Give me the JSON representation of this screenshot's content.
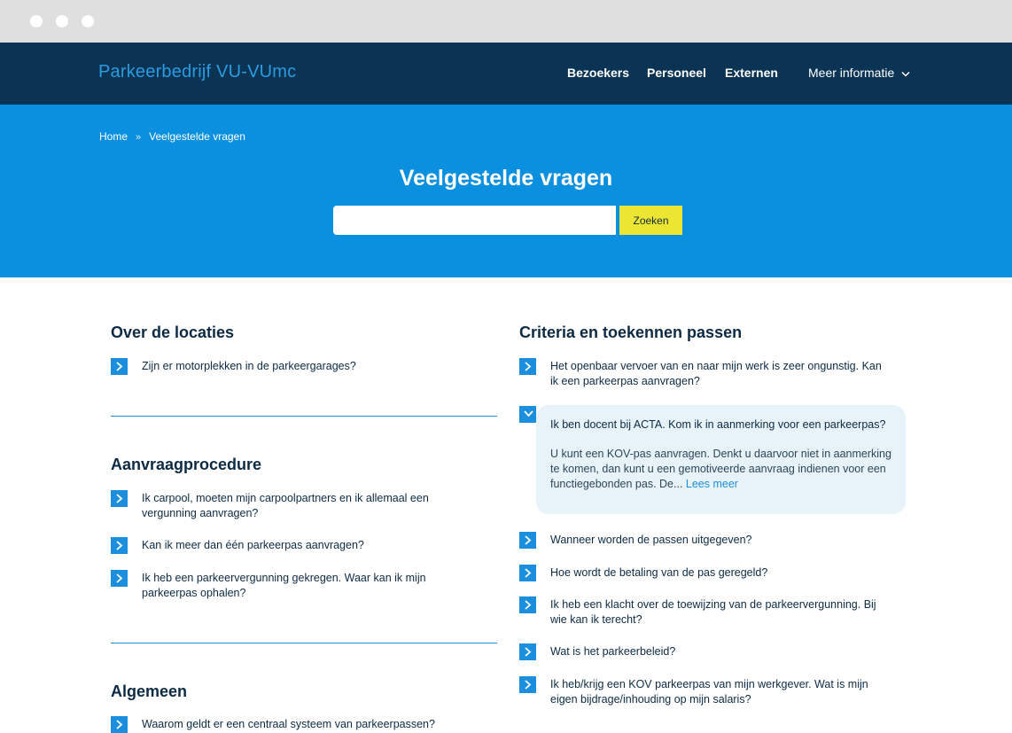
{
  "colors": {
    "navbar_bg": "#0b3454",
    "brand": "#2a9be0",
    "hero_bg": "#0b90df",
    "search_button": "#ece531",
    "accent": "#1b8fde",
    "answer_bg": "#e8f2f9"
  },
  "header": {
    "brand": "Parkeerbedrijf VU-VUmc",
    "nav": {
      "bezoekers": "Bezoekers",
      "personeel": "Personeel",
      "externen": "Externen",
      "meer": "Meer informatie"
    }
  },
  "breadcrumb": {
    "home": "Home",
    "separator": "»",
    "current": "Veelgestelde vragen"
  },
  "hero": {
    "title": "Veelgestelde vragen",
    "search_value": "",
    "search_button": "Zoeken"
  },
  "left": {
    "locaties": {
      "title": "Over de locaties",
      "questions": [
        "Zijn er motorplekken in de parkeergarages?"
      ]
    },
    "aanvraag": {
      "title": "Aanvraagprocedure",
      "questions": [
        "Ik carpool, moeten mijn carpoolpartners en ik allemaal een vergunning aanvragen?",
        "Kan ik meer dan één parkeerpas aanvragen?",
        "Ik heb een parkeervergunning gekregen. Waar kan ik mijn parkeerpas ophalen?"
      ]
    },
    "algemeen": {
      "title": "Algemeen",
      "questions": [
        "Waarom geldt er een centraal systeem van parkeerpassen?"
      ]
    }
  },
  "right": {
    "title": "Criteria en toekennen passen",
    "questions": [
      "Het openbaar vervoer van en naar mijn werk is zeer ongunstig. Kan ik een parkeerpas aanvragen?",
      "Ik ben docent bij ACTA. Kom ik in aanmerking voor een parkeerpas?",
      "Wanneer worden de passen uitgegeven?",
      "Hoe wordt de betaling van de pas geregeld?",
      "Ik heb een klacht over de toewijzing van de parkeervergunning. Bij wie kan ik terecht?",
      "Wat is het parkeerbeleid?",
      "Ik heb/krijg een KOV parkeerpas van mijn werkgever. Wat is mijn eigen bijdrage/inhouding op mijn salaris?"
    ],
    "open_answer": {
      "text": "U kunt een KOV-pas aanvragen. Denkt u daarvoor niet in aanmerking te komen, dan kunt u een gemotiveerde aanvraag indienen voor een functiegebonden pas. De...",
      "more": "Lees meer"
    }
  }
}
